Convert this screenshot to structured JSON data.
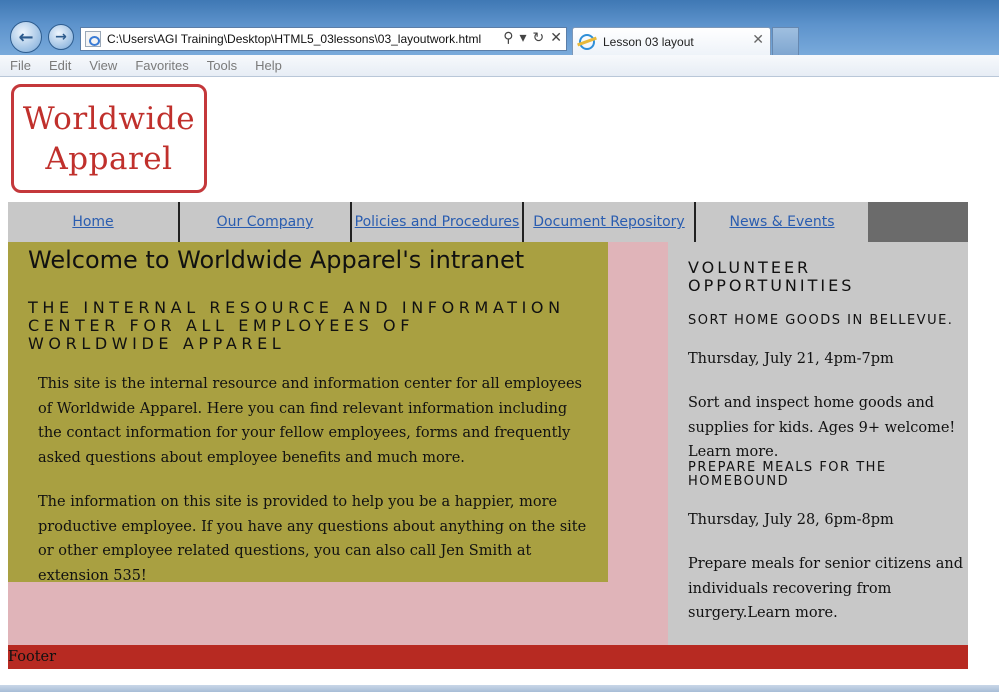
{
  "browser": {
    "address": "C:\\Users\\AGI Training\\Desktop\\HTML5_03lessons\\03_layoutwork.html",
    "tab_title": "Lesson 03 layout",
    "menu": [
      "File",
      "Edit",
      "View",
      "Favorites",
      "Tools",
      "Help"
    ],
    "back_icon": "back-arrow-icon",
    "forward_icon": "forward-arrow-icon"
  },
  "page": {
    "logo": {
      "line1": "Worldwide",
      "line2": "Apparel"
    },
    "nav": [
      "Home",
      "Our Company",
      "Policies and Procedures",
      "Document Repository",
      "News & Events"
    ],
    "main": {
      "heading": "Welcome to Worldwide Apparel's intranet",
      "tagline": "The internal resource and information center for all employees of Worldwide Apparel",
      "paragraphs": [
        "This site is the internal resource and information center for all employees of Worldwide Apparel. Here you can find relevant information including the contact information for your fellow employees, forms and frequently asked questions about employee benefits and much more.",
        "The information on this site is provided to help you be a happier, more productive employee. If you have any questions about anything on the site or other employee related questions, you can also call Jen Smith at extension 535!"
      ]
    },
    "sidebar": {
      "heading": "Volunteer Opportunities",
      "events": [
        {
          "title": "Sort home goods in Bellevue.",
          "date": "Thursday, July 21, 4pm-7pm",
          "description": "Sort and inspect home goods and supplies for kids. Ages 9+ welcome! Learn more."
        },
        {
          "title": "Prepare meals for the homebound",
          "date": "Thursday, July 28, 6pm-8pm",
          "description": "Prepare meals for senior citizens and individuals recovering from surgery.Learn more."
        }
      ]
    },
    "footer": "Footer"
  },
  "colors": {
    "logo_red": "#c0302c",
    "nav_gray": "#c8c8c8",
    "main_olive": "#a9a041",
    "content_pink": "#e0b4b9",
    "sidebar_gray": "#c8c8c8",
    "footer_red": "#b72a22",
    "link_blue": "#2a5db0"
  }
}
